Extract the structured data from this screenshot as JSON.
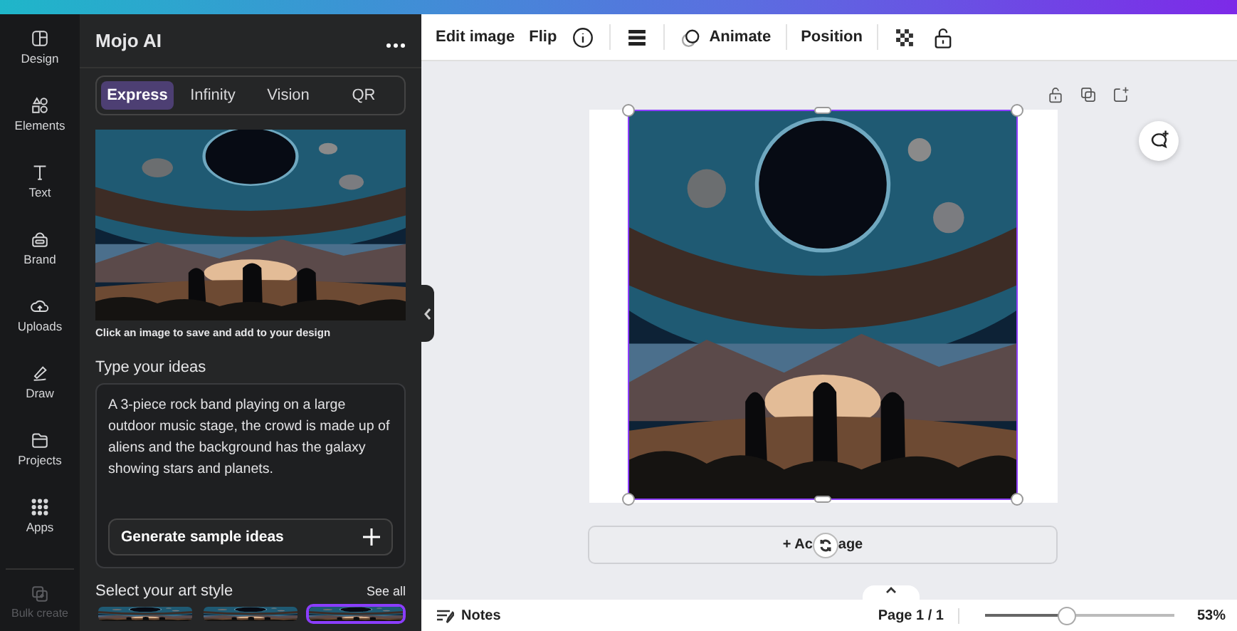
{
  "rail": [
    {
      "label": "Design",
      "disabled": false
    },
    {
      "label": "Elements",
      "disabled": false
    },
    {
      "label": "Text",
      "disabled": false
    },
    {
      "label": "Brand",
      "disabled": false
    },
    {
      "label": "Uploads",
      "disabled": false
    },
    {
      "label": "Draw",
      "disabled": false
    },
    {
      "label": "Projects",
      "disabled": false
    },
    {
      "label": "Apps",
      "disabled": false
    },
    {
      "label": "Bulk create",
      "disabled": true
    }
  ],
  "panel": {
    "title": "Mojo AI",
    "tabs": [
      {
        "label": "Express",
        "selected": true
      },
      {
        "label": "Infinity",
        "selected": false
      },
      {
        "label": "Vision",
        "selected": false
      },
      {
        "label": "QR",
        "selected": false
      }
    ],
    "caption": "Click an image to save and add to your design",
    "ideas_label": "Type your ideas",
    "ideas_value": "A 3-piece rock band playing on a large outdoor music stage, the crowd is made up of aliens and the background has the galaxy showing stars and planets.",
    "generate_button": "Generate sample ideas",
    "art_style_label": "Select your art style",
    "see_all": "See all",
    "art_styles": [
      {
        "selected": false
      },
      {
        "selected": false
      },
      {
        "selected": true
      }
    ]
  },
  "toolbar": [
    {
      "kind": "text",
      "label": "Edit image"
    },
    {
      "kind": "text",
      "label": "Flip"
    },
    {
      "kind": "icon"
    },
    {
      "kind": "divider"
    },
    {
      "kind": "icon"
    },
    {
      "kind": "divider"
    },
    {
      "kind": "icon-text",
      "label": "Animate"
    },
    {
      "kind": "divider"
    },
    {
      "kind": "text",
      "label": "Position"
    },
    {
      "kind": "divider"
    },
    {
      "kind": "icon"
    },
    {
      "kind": "icon"
    }
  ],
  "add_page": {
    "visible_start": "+ Ac",
    "visible_end": "age"
  },
  "status_bar": {
    "notes": "Notes",
    "page": "Page 1 / 1",
    "zoom_slider": {
      "level": 0.43
    },
    "zoom": "53%"
  }
}
